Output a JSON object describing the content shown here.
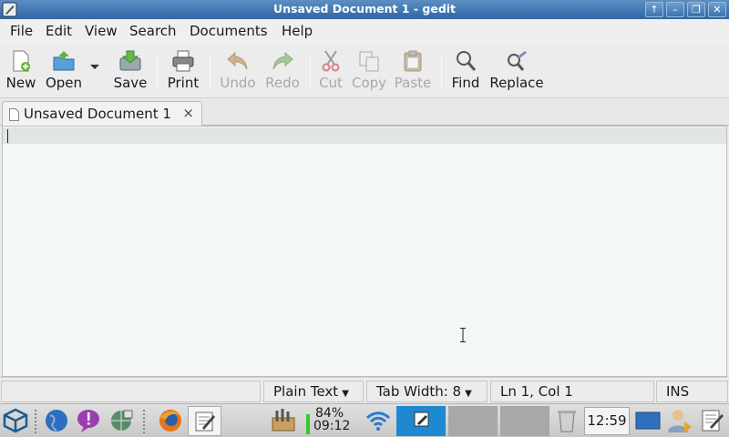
{
  "window": {
    "title": "Unsaved Document 1 - gedit"
  },
  "menu": [
    "File",
    "Edit",
    "View",
    "Search",
    "Documents",
    "Help"
  ],
  "toolbar": {
    "new": "New",
    "open": "Open",
    "save": "Save",
    "print": "Print",
    "undo": "Undo",
    "redo": "Redo",
    "cut": "Cut",
    "copy": "Copy",
    "paste": "Paste",
    "find": "Find",
    "replace": "Replace"
  },
  "tab": {
    "label": "Unsaved Document 1",
    "close": "×"
  },
  "statusbar": {
    "language": "Plain Text",
    "tab_width": "Tab Width: 8",
    "position": "Ln 1, Col 1",
    "mode": "INS"
  },
  "taskbar": {
    "battery_percent": "84%",
    "battery_time": "09:12",
    "clock": "12:59"
  },
  "colors": {
    "titlebar": "#2f66a3",
    "editor_bg": "#f4f8f4",
    "battery": "#2ecc2e",
    "active_task": "#1e88d0"
  }
}
